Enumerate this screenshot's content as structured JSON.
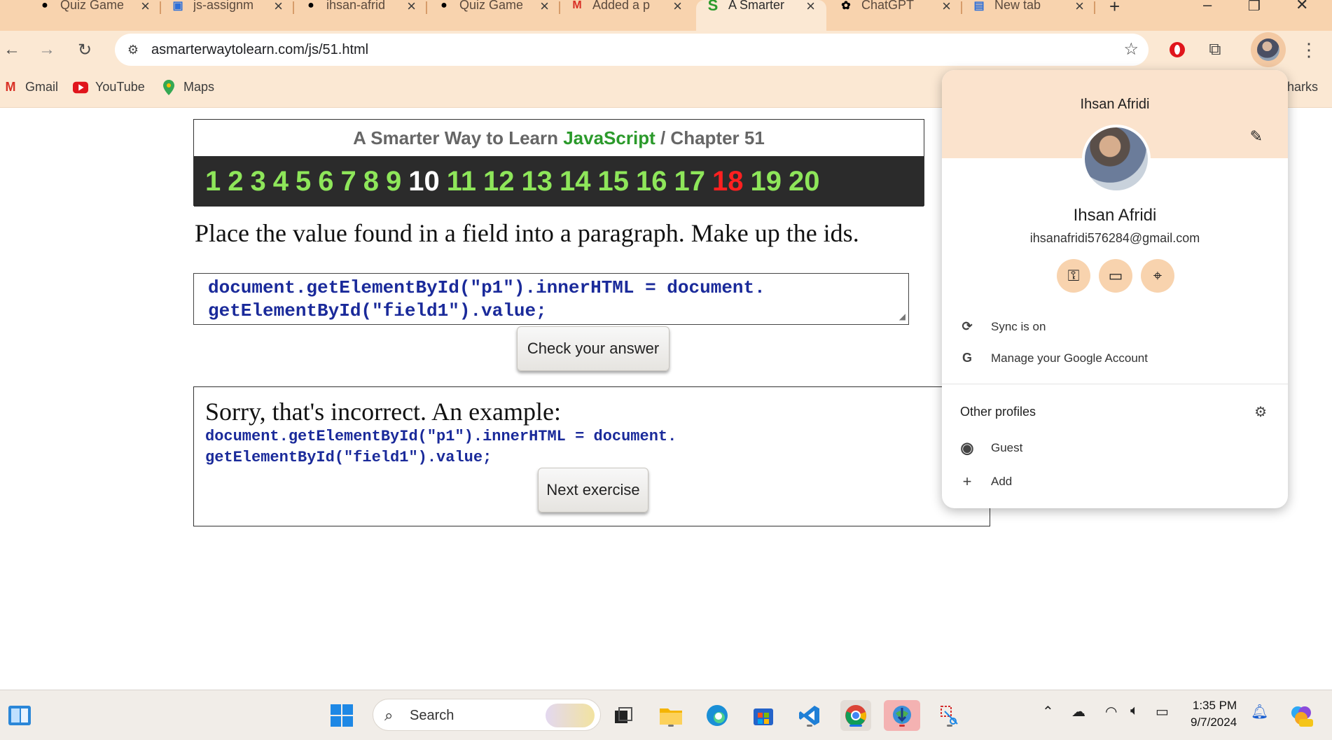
{
  "browser": {
    "tabs": [
      {
        "title": "Quiz Game",
        "icon": "github-icon"
      },
      {
        "title": "js-assignm",
        "icon": "classroom-icon"
      },
      {
        "title": "ihsan-afrid",
        "icon": "github-icon"
      },
      {
        "title": "Quiz Game",
        "icon": "github-icon"
      },
      {
        "title": "Added a p",
        "icon": "gmail-icon"
      },
      {
        "title": "A Smarter",
        "icon": "asmarterway-icon"
      },
      {
        "title": "ChatGPT",
        "icon": "chatgpt-icon"
      },
      {
        "title": "New tab",
        "icon": "newtab-icon"
      }
    ],
    "url": "asmarterwaytolearn.com/js/51.html",
    "bookmarks": [
      {
        "label": "Gmail"
      },
      {
        "label": "YouTube"
      },
      {
        "label": "Maps"
      }
    ],
    "bookmarks_right": "harks"
  },
  "page": {
    "header_prefix": "A Smarter Way to Learn ",
    "header_js": "JavaScript",
    "header_suffix": " / Chapter 51",
    "exercises": [
      "1",
      "2",
      "3",
      "4",
      "5",
      "6",
      "7",
      "8",
      "9",
      "10",
      "11",
      "12",
      "13",
      "14",
      "15",
      "16",
      "17",
      "18",
      "19",
      "20"
    ],
    "current_exercise": "10",
    "wrong_exercise": "18",
    "prompt": "Place the value found in a field into a paragraph. Make up the ids.",
    "answer_line1": "document.getElementById(\"p1\").innerHTML = document.",
    "answer_line2": "getElementById(\"field1\").value;",
    "check_button": "Check your answer",
    "result_message": "Sorry, that's incorrect. An example:",
    "example_line1": "document.getElementById(\"p1\").innerHTML = document.",
    "example_line2": "getElementById(\"field1\").value;",
    "next_button": "Next exercise"
  },
  "profile": {
    "header_name": "Ihsan Afridi",
    "name": "Ihsan Afridi",
    "email": "ihsanafridi576284@gmail.com",
    "sync": "Sync is on",
    "manage": "Manage your Google Account",
    "other_profiles": "Other profiles",
    "guest": "Guest",
    "add": "Add"
  },
  "taskbar": {
    "search": "Search",
    "time": "1:35 PM",
    "date": "9/7/2024"
  },
  "colors": {
    "tab_strip": "#f8d3ae",
    "toolbar": "#fbe8d3",
    "exercise_green": "#8ee65a",
    "exercise_red": "#ff2020",
    "code_blue": "#1a2a9a"
  }
}
